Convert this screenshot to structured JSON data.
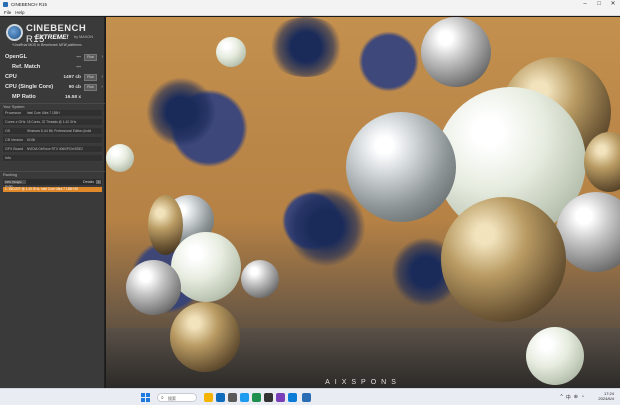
{
  "window": {
    "title": "CINEBENCH R15",
    "controls": [
      "–",
      "□",
      "✕"
    ]
  },
  "menu": [
    "File",
    "Help"
  ],
  "logo": {
    "brand_a": "CINEBENCH",
    "brand_b": " R15",
    "sub": "EXTREME!",
    "maxon": "by MAXON",
    "note": "*Unofficial MOD to Benchmark NEW platforms"
  },
  "benchmarks": [
    {
      "label": "OpenGL",
      "value": "---",
      "button": "Run"
    },
    {
      "label": "Ref. Match",
      "value": "---",
      "button": ""
    },
    {
      "label": "CPU",
      "value": "1497 cb",
      "button": "Run"
    },
    {
      "label": "CPU (Single Core)",
      "value": "90 cb",
      "button": "Run"
    },
    {
      "label": "MP Ratio",
      "value": "16.58 x",
      "button": ""
    }
  ],
  "system": {
    "heading": "Your System",
    "rows": [
      {
        "k": "Processor",
        "v": "Intel Core Ultra 7 155H"
      },
      {
        "k": "Cores x GHz",
        "v": "16 Cores, 22 Threads @ 1.40 GHz"
      },
      {
        "k": "OS",
        "v": "Windows 8, 64 Bit, Professional Edition (build"
      },
      {
        "k": "CB Version",
        "v": "64 Bit"
      },
      {
        "k": "GFX Board",
        "v": "NVIDIA GeForce RTX 4060/PCIe/SSE2"
      },
      {
        "k": "Info",
        "v": ""
      }
    ]
  },
  "ranking": {
    "heading": "Ranking",
    "selector": "CPU (Single Core)",
    "details": "Details",
    "info": "i",
    "entry": "1. 16C/22T @ 1.40 GHz, Intel Core Ultra 7 155H 90"
  },
  "render": {
    "watermark": "AIXSPONS"
  },
  "taskbar": {
    "search": "搜索",
    "time": "17:24",
    "date": "2024/6/4",
    "tray": [
      "^",
      "中",
      "⊕",
      "◔"
    ]
  },
  "colors": {
    "accent": "#e0892a",
    "panel": "#3a3a3a"
  }
}
